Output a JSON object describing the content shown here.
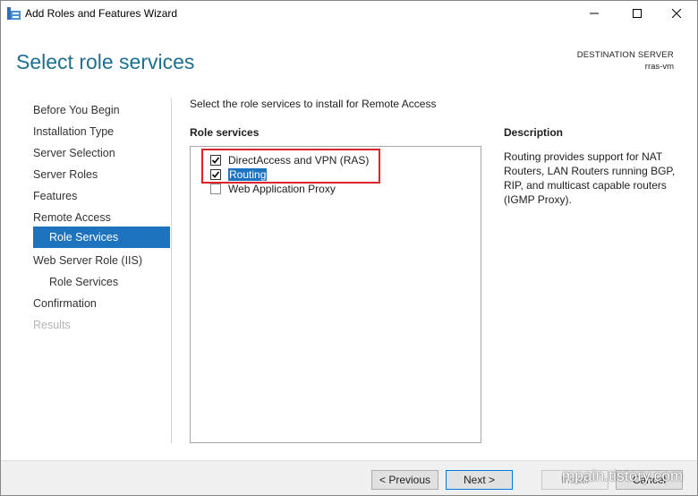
{
  "window": {
    "title": "Add Roles and Features Wizard"
  },
  "header": {
    "page_title": "Select role services",
    "destination_label": "DESTINATION SERVER",
    "destination_value": "rras-vm"
  },
  "nav": {
    "items": [
      {
        "label": "Before You Begin"
      },
      {
        "label": "Installation Type"
      },
      {
        "label": "Server Selection"
      },
      {
        "label": "Server Roles"
      },
      {
        "label": "Features"
      },
      {
        "label": "Remote Access"
      },
      {
        "label": "Role Services"
      },
      {
        "label": "Web Server Role (IIS)"
      },
      {
        "label": "Role Services"
      },
      {
        "label": "Confirmation"
      },
      {
        "label": "Results"
      }
    ]
  },
  "main": {
    "instruction": "Select the role services to install for Remote Access",
    "role_services_heading": "Role services",
    "role_services": [
      {
        "label": "DirectAccess and VPN (RAS)",
        "checked": true
      },
      {
        "label": "Routing",
        "checked": true
      },
      {
        "label": "Web Application Proxy",
        "checked": false
      }
    ],
    "description_heading": "Description",
    "description_text": "Routing provides support for NAT Routers, LAN Routers running BGP, RIP, and multicast capable routers (IGMP Proxy)."
  },
  "footer": {
    "previous_label": "< Previous",
    "next_label": "Next >",
    "install_label": "Install",
    "cancel_label": "Cancel"
  },
  "watermark": "mpain.tistory.com",
  "colors": {
    "accent": "#1e73be",
    "heading": "#1f6f8f",
    "highlight_box": "#d9252b"
  }
}
